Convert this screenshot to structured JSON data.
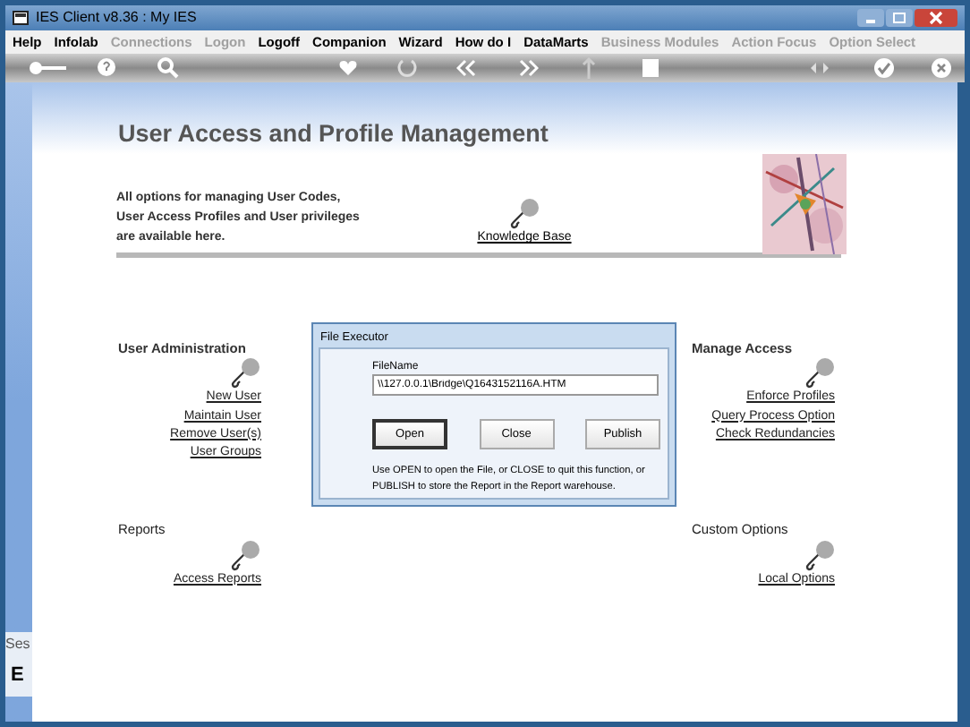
{
  "window": {
    "title": "IES Client v8.36 : My IES"
  },
  "menu": [
    {
      "label": "Help",
      "disabled": false
    },
    {
      "label": "Infolab",
      "disabled": false
    },
    {
      "label": "Connections",
      "disabled": true
    },
    {
      "label": "Logon",
      "disabled": true
    },
    {
      "label": "Logoff",
      "disabled": false
    },
    {
      "label": "Companion",
      "disabled": false
    },
    {
      "label": "Wizard",
      "disabled": false
    },
    {
      "label": "How do I",
      "disabled": false
    },
    {
      "label": "DataMarts",
      "disabled": false
    },
    {
      "label": "Business Modules",
      "disabled": true
    },
    {
      "label": "Action Focus",
      "disabled": true
    },
    {
      "label": "Option Select",
      "disabled": true
    }
  ],
  "page": {
    "title": "User Access and Profile Management",
    "intro": [
      "All options for managing User Codes,",
      "User Access Profiles and User privileges",
      "are available here."
    ],
    "knowledge_link": "Knowledge Base"
  },
  "section_rows": [
    {
      "left": {
        "title": "User Administration",
        "links": [
          "New User",
          "Maintain User",
          "Remove User(s)",
          "User Groups"
        ]
      },
      "right": {
        "title": "Manage Access",
        "links": [
          "Enforce Profiles",
          "Query Process Option",
          "Check Redundancies"
        ]
      }
    },
    {
      "left": {
        "title": "Reports",
        "links": [
          "Access Reports"
        ]
      },
      "right": {
        "title": "Custom Options",
        "links": [
          "Local Options"
        ]
      }
    }
  ],
  "dialog": {
    "title": "File Executor",
    "field_label": "FileName",
    "field_value": "\\\\127.0.0.1\\Bridge\\Q1643152116A.HTM",
    "buttons": [
      {
        "label": "Open",
        "default": true
      },
      {
        "label": "Close",
        "default": false
      },
      {
        "label": "Publish",
        "default": false
      }
    ],
    "help": [
      "Use OPEN to open the File, or CLOSE to quit this function, or",
      "PUBLISH to store the Report in the Report warehouse."
    ]
  },
  "side_panel": {
    "label": "Ses",
    "letter": "E"
  }
}
